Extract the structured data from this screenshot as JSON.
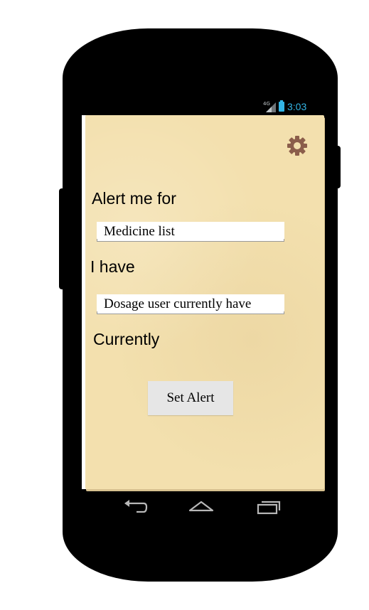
{
  "status_bar": {
    "network_label": "4G",
    "network_icon": "signal-icon",
    "battery_icon": "battery-icon",
    "time": "3:03",
    "accent_color": "#33b5e5"
  },
  "app": {
    "settings_icon": "gear-icon",
    "alert_label": "Alert me for",
    "medicine_field": {
      "value": "Medicine list"
    },
    "have_label": "I have",
    "dosage_field": {
      "value": "Dosage user currently have"
    },
    "currently_label": "Currently",
    "set_alert_button": "Set Alert",
    "background_color": "#f3e0ae"
  },
  "nav_bar": {
    "back_icon": "back-icon",
    "home_icon": "home-icon",
    "recents_icon": "recents-icon"
  }
}
